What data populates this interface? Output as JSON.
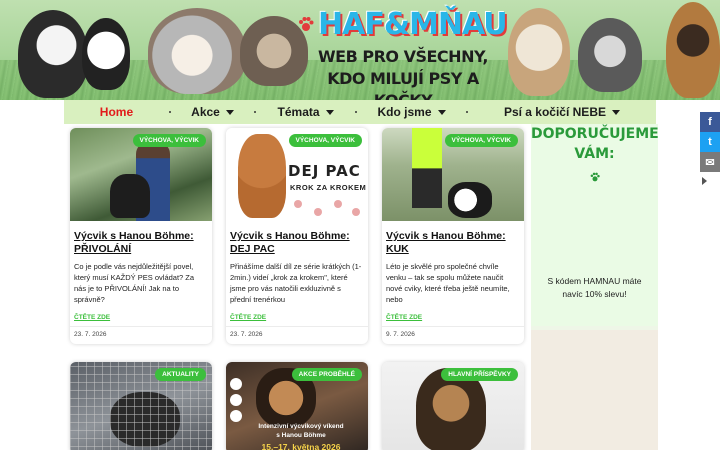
{
  "site": {
    "logo_text": "HAF&MŇAU",
    "tagline_line1": "WEB PRO VŠECHNY,",
    "tagline_line2": "KDO MILUJÍ PSY A KOČKY"
  },
  "nav": {
    "items": [
      {
        "label": "Home",
        "active": true
      },
      {
        "label": "Akce",
        "has_dropdown": true
      },
      {
        "label": "Témata",
        "has_dropdown": true
      },
      {
        "label": "Kdo jsme",
        "has_dropdown": true
      },
      {
        "label": "Psí a kočičí NEBE",
        "has_dropdown": true
      }
    ],
    "active_color": "#e11b1b",
    "background": "#d9f0bf"
  },
  "social": {
    "facebook": "f",
    "twitter": "t",
    "email": "✉"
  },
  "posts": [
    {
      "badge": "VÝCHOVA, VÝCVIK",
      "title": "Výcvik s Hanou Böhme: PŘIVOLÁNÍ",
      "excerpt": "Co je podle vás nejdůležitější povel, který musí KAŽDÝ PES ovládat? Za nás je to PŘIVOLÁNÍ! Jak na to správně?",
      "more": "ČTĚTE ZDE",
      "date": "23. 7. 2026"
    },
    {
      "badge": "VÝCHOVA, VÝCVIK",
      "title": "Výcvik s Hanou Böhme: DEJ PAC",
      "excerpt": "Přinášíme další díl ze série krátkých (1-2min.) videí „krok za krokem\", které jsme pro vás natočili exkluzivně s přední trenérkou",
      "more": "ČTĚTE ZDE",
      "date": "23. 7. 2026",
      "image_headline": "DEJ PAC",
      "image_sub": "KROK ZA KROKEM"
    },
    {
      "badge": "VÝCHOVA, VÝCVIK",
      "title": "Výcvik s Hanou Böhme: KUK",
      "excerpt": "Léto je skvělé pro společné chvíle venku – tak se spolu můžete naučit nové cviky, které třeba ještě neumíte, nebo",
      "more": "ČTĚTE ZDE",
      "date": "9. 7. 2026"
    },
    {
      "badge": "AKTUALITY"
    },
    {
      "badge": "AKCE PROBĚHLÉ",
      "image_event_line1": "Intenzivní výcvikový víkend",
      "image_event_line2": "s Hanou Böhme",
      "image_date": "15.–17. května 2026"
    },
    {
      "badge": "HLAVNÍ PŘÍSPĚVKY"
    }
  ],
  "sidebar": {
    "title": "DOPORUČUJEME VÁM:",
    "promo": "S kódem HAMNAU máte navíc 10% slevu!"
  },
  "colors": {
    "accent_green": "#3cbf3c",
    "sidebar_title": "#2a9a3a",
    "logo_blue": "#29b6e8",
    "logo_red": "#e23b3b"
  }
}
